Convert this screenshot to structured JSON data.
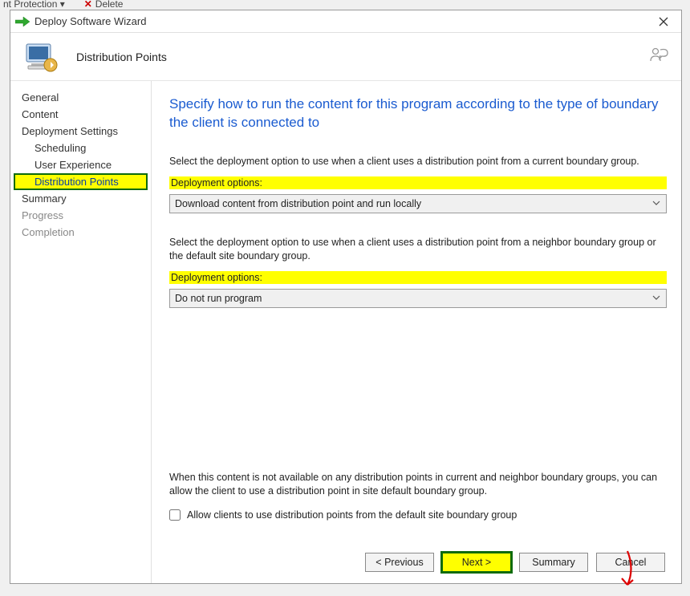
{
  "ribbon": {
    "left": "nt Protection ▾",
    "right_x": "✕",
    "right_label": "Delete"
  },
  "window": {
    "title": "Deploy Software Wizard"
  },
  "banner": {
    "page_name": "Distribution Points"
  },
  "sidebar": {
    "items": [
      {
        "label": "General"
      },
      {
        "label": "Content"
      },
      {
        "label": "Deployment Settings"
      },
      {
        "label": "Scheduling"
      },
      {
        "label": "User Experience"
      },
      {
        "label": "Distribution Points"
      },
      {
        "label": "Summary"
      },
      {
        "label": "Progress"
      },
      {
        "label": "Completion"
      }
    ]
  },
  "content": {
    "heading": "Specify how to run the content for this program according to the type of boundary the client is connected to",
    "section1": {
      "desc": "Select the deployment option to use when a client uses a distribution point from a current boundary group.",
      "label": "Deployment options:",
      "value": "Download content from distribution point and run locally"
    },
    "section2": {
      "desc": "Select the deployment option to use when a client uses a distribution point from a neighbor boundary group or the default site boundary group.",
      "label": "Deployment options:",
      "value": "Do not run program"
    },
    "fallback": {
      "desc": "When this content is not available on any distribution points in current and neighbor boundary groups, you can allow the client to use a distribution point in site default boundary group.",
      "checkbox_label": "Allow clients to use distribution points from the default site boundary group"
    }
  },
  "buttons": {
    "previous": "< Previous",
    "next": "Next >",
    "summary": "Summary",
    "cancel": "Cancel"
  }
}
